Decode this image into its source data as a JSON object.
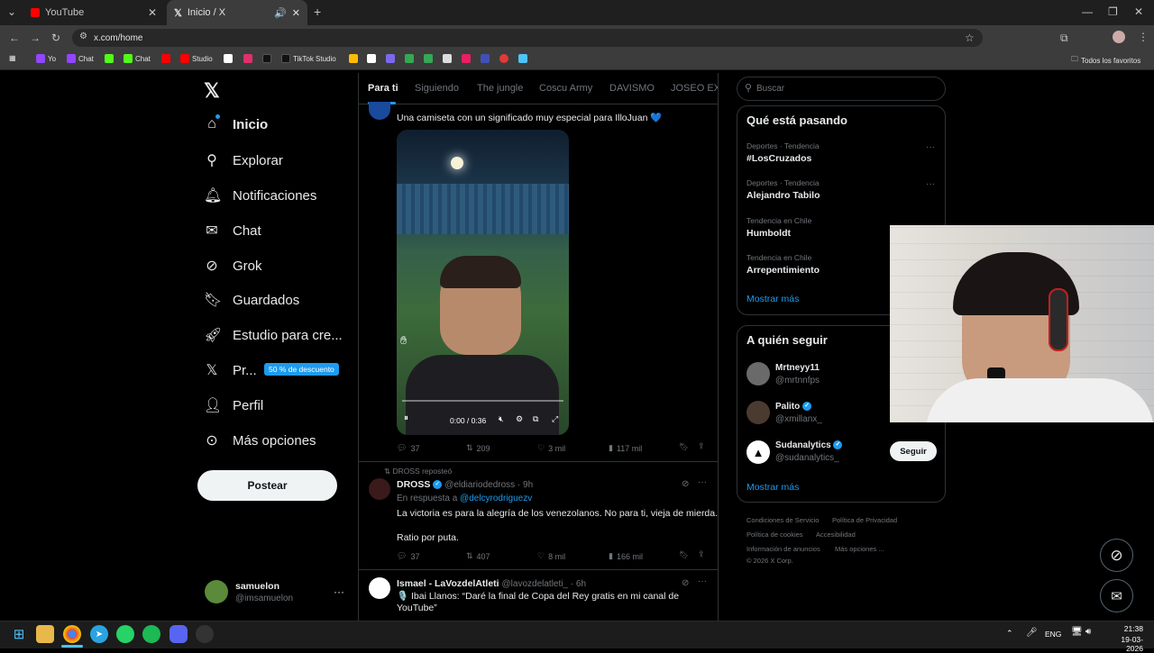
{
  "browser": {
    "tabs": [
      {
        "label": "YouTube",
        "active": false
      },
      {
        "label": "Inicio / X",
        "active": true
      }
    ],
    "address": "x.com/home",
    "bookmarks": [
      "Yo",
      "Chat",
      "Chat",
      "Studio",
      "TikTok Studio"
    ],
    "all_bookmarks": "Todos los favoritos"
  },
  "nav": {
    "items": [
      "Inicio",
      "Explorar",
      "Notificaciones",
      "Chat",
      "Grok",
      "Guardados",
      "Estudio para cre...",
      "Pr...",
      "Perfil",
      "Más opciones"
    ],
    "promo_badge": "50 % de descuento",
    "post_button": "Postear",
    "user_name": "samuelon",
    "user_handle": "@imsamuelon"
  },
  "feed": {
    "tabs": [
      "Para ti",
      "Siguiendo",
      "The jungle",
      "Coscu Army",
      "DAVISMO",
      "JOSEO EXC"
    ],
    "post1": {
      "text": "Una camiseta con un significado muy especial para IlloJuan 💙",
      "video_time": "0:00 / 0:36",
      "replies": "37",
      "reposts": "209",
      "likes": "3 mil",
      "views": "117 mil"
    },
    "post2": {
      "repost_note": "DROSS reposteó",
      "name": "DROSS",
      "handle": "@eldiariodedross · 9h",
      "reply_to_prefix": "En respuesta a",
      "reply_to": "@delcyrodriguezv",
      "text1": "La victoria es para la alegría de los venezolanos. No para ti, vieja de mierda.",
      "text2": "Ratio por puta.",
      "replies": "37",
      "reposts": "407",
      "likes": "8 mil",
      "views": "166 mil"
    },
    "post3": {
      "name": "Ismael - LaVozdelAtleti",
      "handle": "@lavozdelatleti_ · 6h",
      "text": "🎙️ Ibai Llanos: “Daré la final de Copa del Rey gratis en mi canal de YouTube”"
    }
  },
  "sidebar": {
    "search_placeholder": "Buscar",
    "trends_title": "Qué está pasando",
    "trends": [
      {
        "cat": "Deportes · Tendencia",
        "name": "#LosCruzados"
      },
      {
        "cat": "Deportes · Tendencia",
        "name": "Alejandro Tabilo"
      },
      {
        "cat": "Tendencia en Chile",
        "name": "Humboldt"
      },
      {
        "cat": "Tendencia en Chile",
        "name": "Arrepentimiento"
      }
    ],
    "show_more": "Mostrar más",
    "follow_title": "A quién seguir",
    "follow": [
      {
        "name": "Mrtneyy11",
        "handle": "@mrtnnfps"
      },
      {
        "name": "Palito",
        "handle": "@xmillanx_"
      },
      {
        "name": "Sudanalytics",
        "handle": "@sudanalytics_"
      }
    ],
    "follow_button": "Seguir",
    "show_more2": "Mostrar más",
    "footer": [
      "Condiciones de Servicio",
      "Política de Privacidad",
      "Política de cookies",
      "Accesibilidad",
      "Información de anuncios",
      "Más opciones ...",
      "© 2026 X Corp."
    ]
  },
  "taskbar": {
    "lang": "ENG",
    "time": "21:38",
    "date": "19-03-2026"
  },
  "colors": {
    "accent": "#1d9bf0",
    "bg": "#000000"
  }
}
